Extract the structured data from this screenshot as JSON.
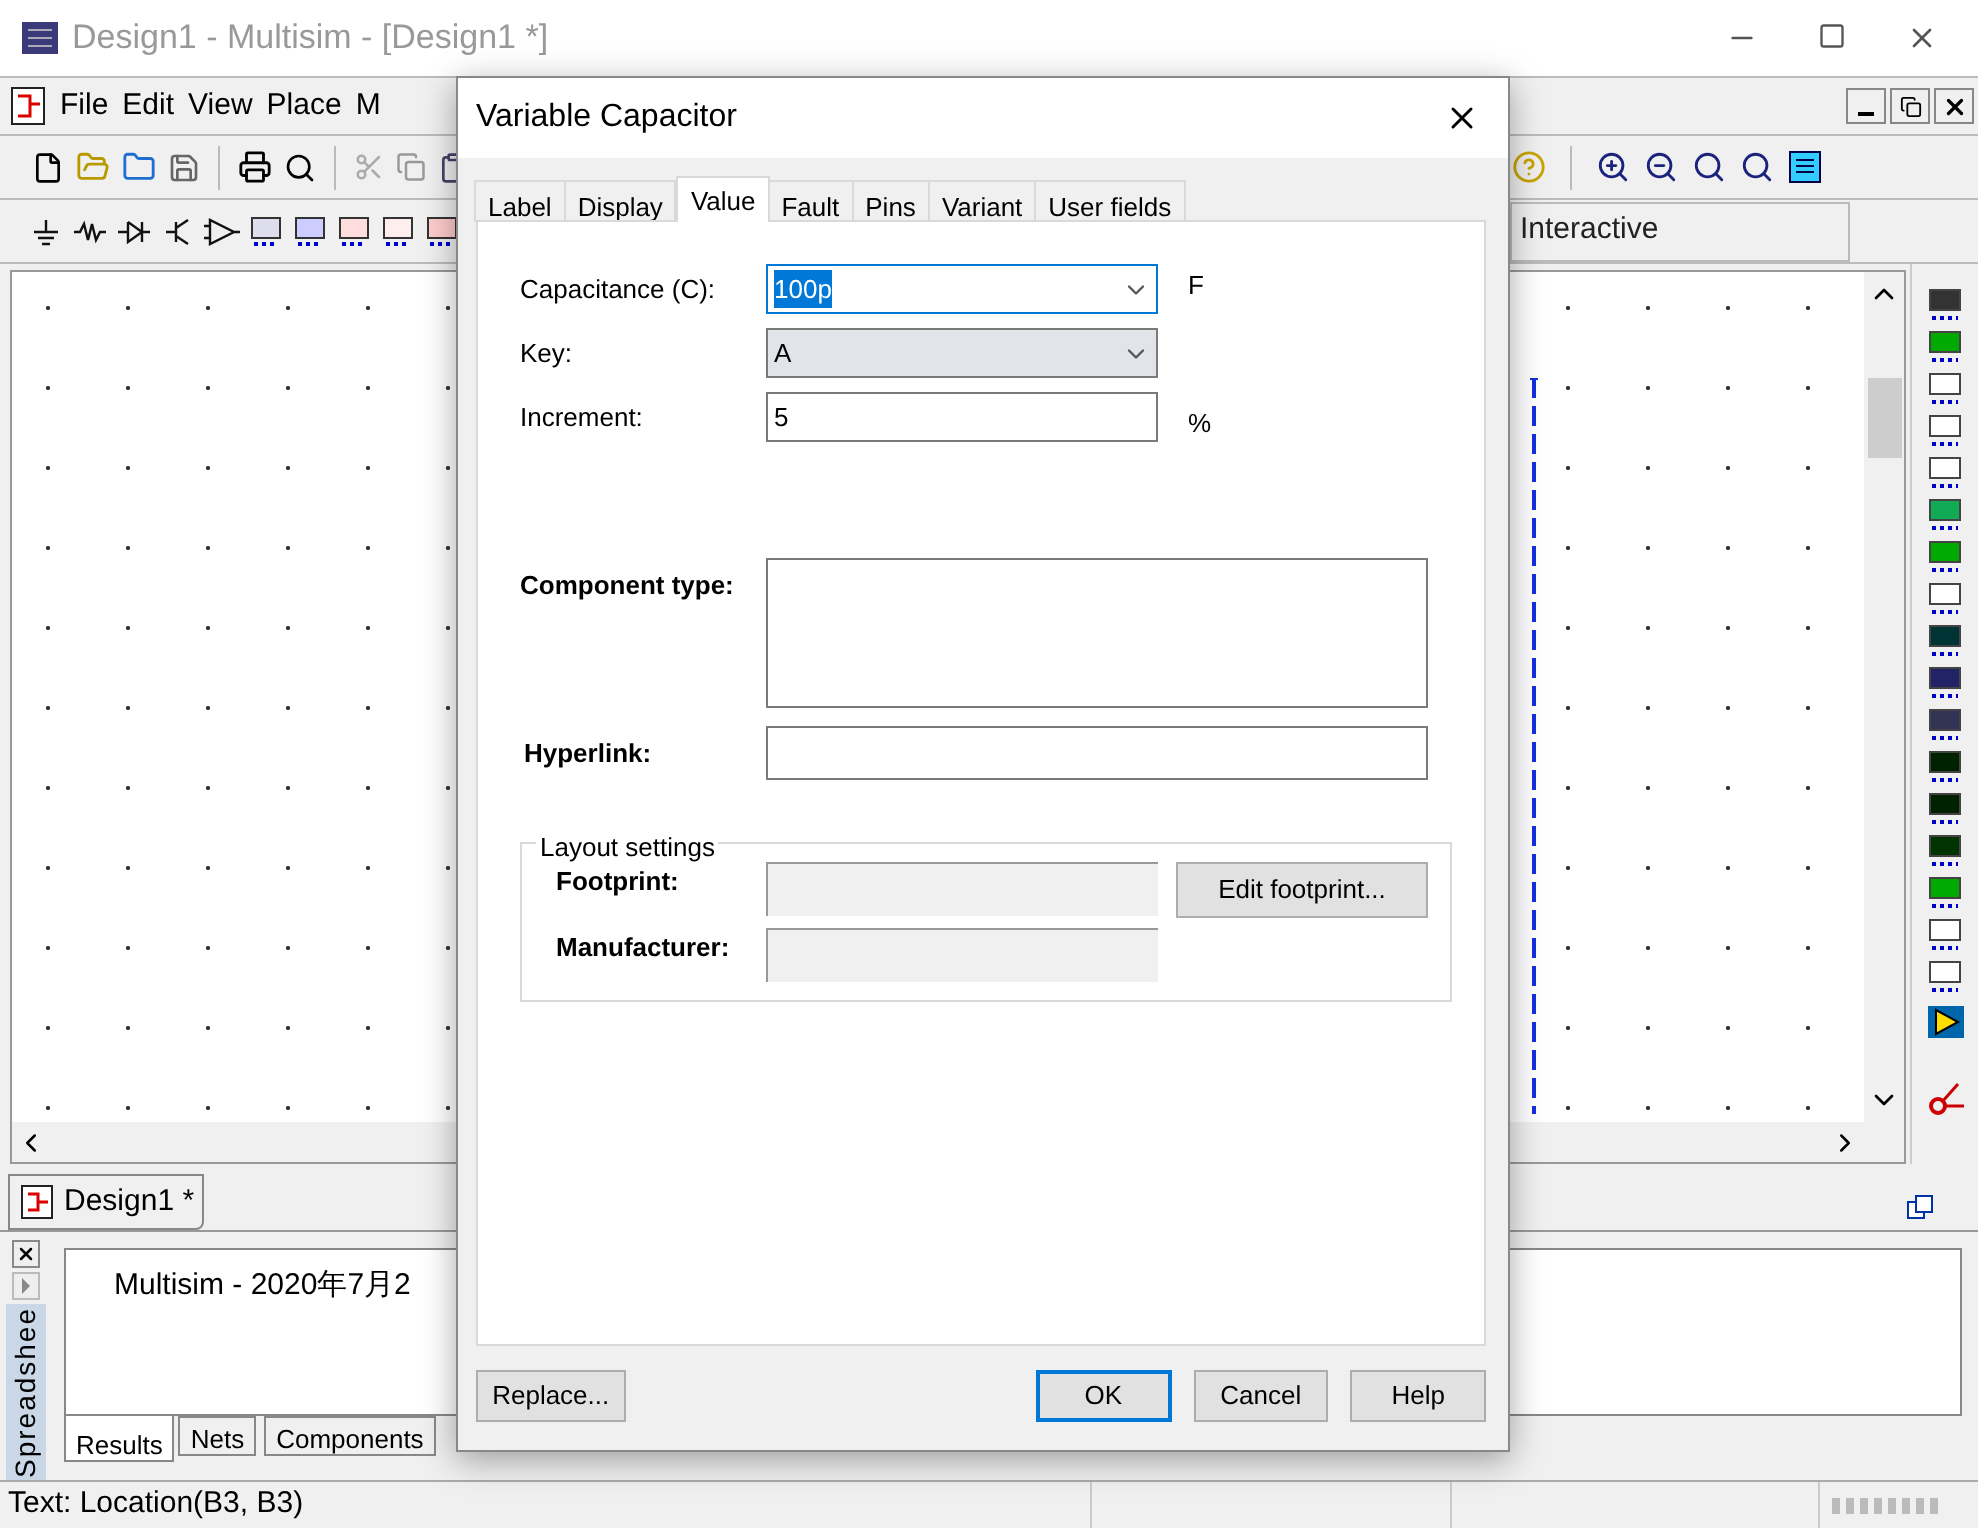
{
  "window": {
    "title": "Design1 - Multisim - [Design1 *]"
  },
  "menu": [
    {
      "label": "File"
    },
    {
      "label": "Edit"
    },
    {
      "label": "View"
    },
    {
      "label": "Place"
    },
    {
      "label": "M"
    }
  ],
  "toolbar": {
    "label": "Interactive"
  },
  "document_tabs": [
    {
      "label": "Design1 *",
      "selected": true
    }
  ],
  "spreadsheet": {
    "title": "Spreadshee",
    "results_text": "Multisim  -  2020年7月2",
    "tabs": [
      {
        "label": "Results",
        "selected": true
      },
      {
        "label": "Nets",
        "selected": false
      },
      {
        "label": "Components",
        "selected": false
      }
    ]
  },
  "status_bar": {
    "text": "Text: Location(B3, B3)"
  },
  "dialog": {
    "title": "Variable Capacitor",
    "tabs": [
      {
        "label": "Label",
        "selected": false
      },
      {
        "label": "Display",
        "selected": false
      },
      {
        "label": "Value",
        "selected": true
      },
      {
        "label": "Fault",
        "selected": false
      },
      {
        "label": "Pins",
        "selected": false
      },
      {
        "label": "Variant",
        "selected": false
      },
      {
        "label": "User fields",
        "selected": false
      }
    ],
    "fields": [
      {
        "label": "Capacitance (C):",
        "kind": "dropdown",
        "value": "100p",
        "unit": "F",
        "focused": true
      },
      {
        "label": "Key:",
        "kind": "dropdown",
        "value": "A",
        "focused": false
      },
      {
        "label": "Increment:",
        "kind": "text",
        "value": "5",
        "unit": "%",
        "focused": false
      }
    ],
    "component_type": {
      "label": "Component type:"
    },
    "hyperlink": {
      "label": "Hyperlink:"
    },
    "layout_settings": {
      "title": "Layout settings",
      "fields": [
        {
          "label": "Footprint:",
          "disabled": true
        },
        {
          "label": "Manufacturer:",
          "disabled": true
        }
      ],
      "edit_button": "Edit footprint..."
    },
    "buttons": [
      {
        "label": "Replace...",
        "default": false
      },
      {
        "label": "OK",
        "default": true
      },
      {
        "label": "Cancel",
        "default": false
      },
      {
        "label": "Help",
        "default": false
      }
    ]
  }
}
